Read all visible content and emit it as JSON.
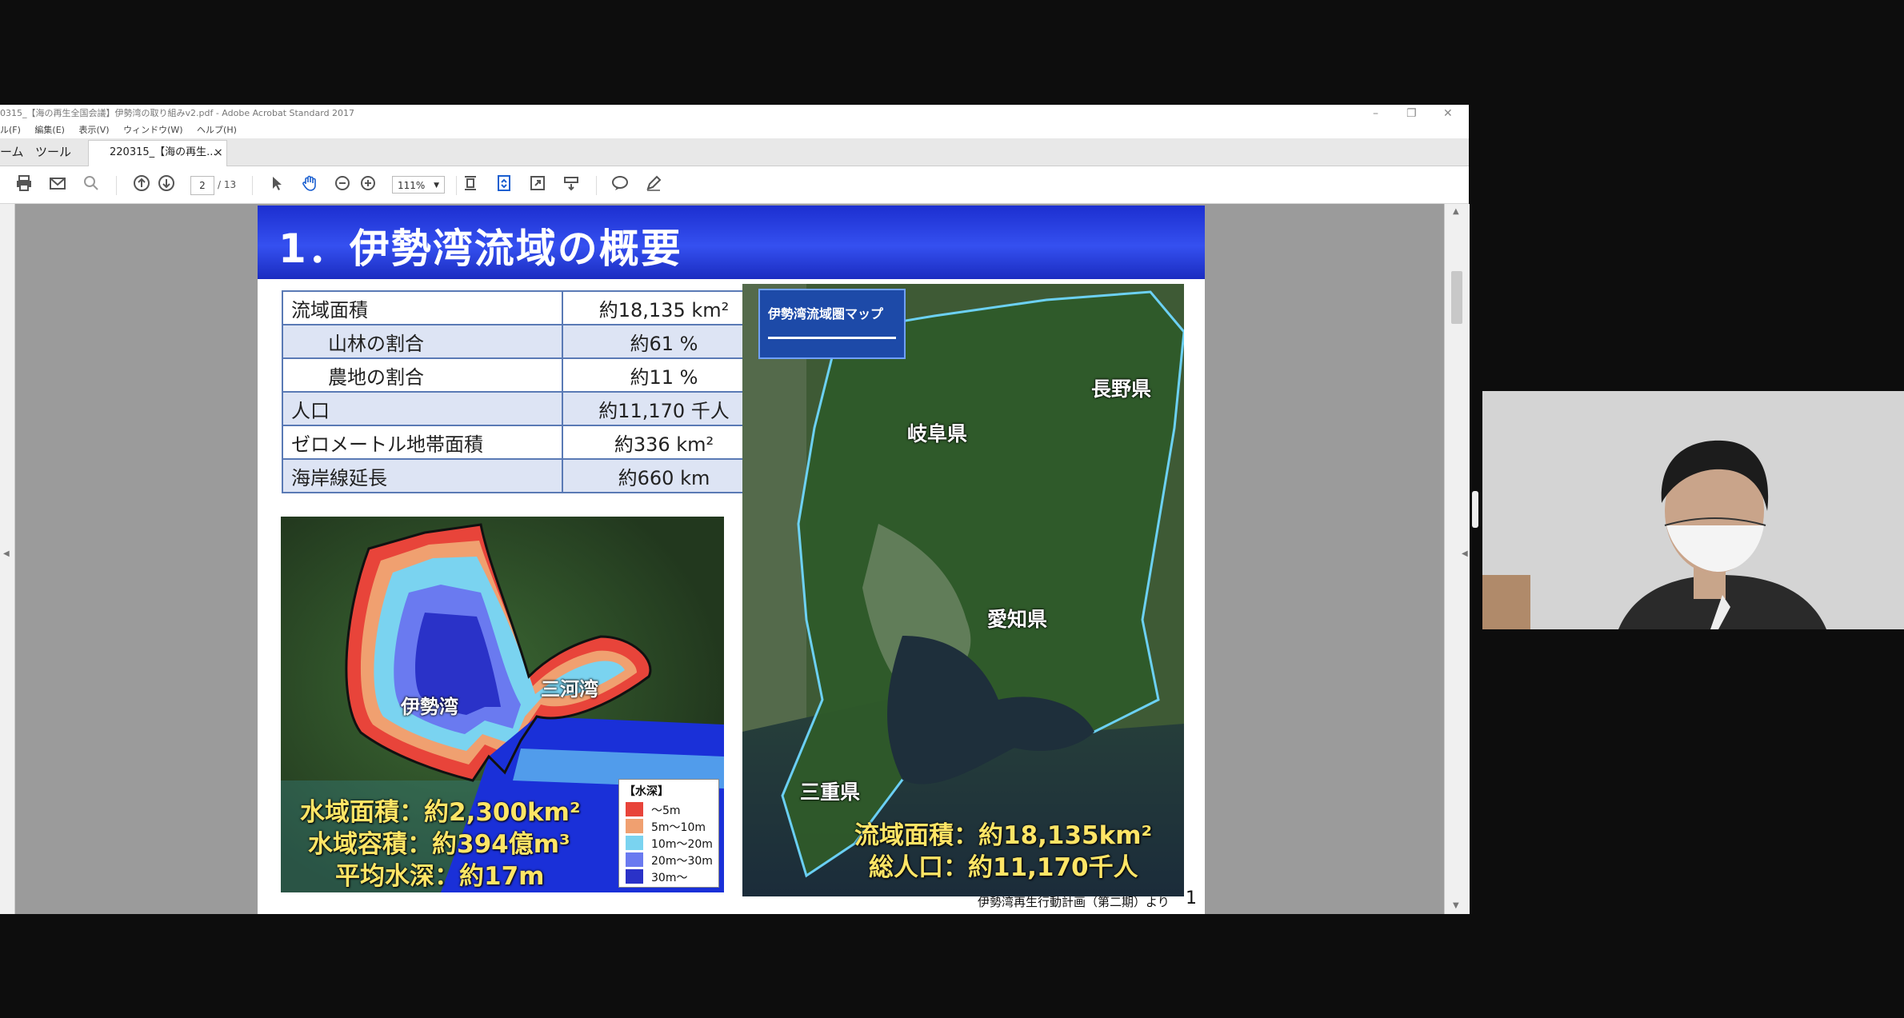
{
  "window": {
    "title": "0315_【海の再生全国会議】伊勢湾の取り組みv2.pdf - Adobe Acrobat Standard 2017",
    "controls": [
      "–",
      "❐",
      "✕"
    ]
  },
  "menu": [
    "ル(F)",
    "編集(E)",
    "表示(V)",
    "ウィンドウ(W)",
    "ヘルプ(H)"
  ],
  "tabs": {
    "home": "ーム",
    "tools": "ツール",
    "document": "220315_【海の再生...",
    "close": "×"
  },
  "toolbar": {
    "page_current": "2",
    "page_total": "/ 13",
    "zoom": "111%"
  },
  "slide": {
    "title": "1．伊勢湾流域の概要",
    "stats": [
      {
        "label": "流域面積",
        "value": "約18,135 km²",
        "indent": false,
        "shade": false
      },
      {
        "label": "山林の割合",
        "value": "約61 %",
        "indent": true,
        "shade": true
      },
      {
        "label": "農地の割合",
        "value": "約11 %",
        "indent": true,
        "shade": false
      },
      {
        "label": "人口",
        "value": "約11,170 千人",
        "indent": false,
        "shade": true
      },
      {
        "label": "ゼロメートル地帯面積",
        "value": "約336 km²",
        "indent": false,
        "shade": false
      },
      {
        "label": "海岸線延長",
        "value": "約660 km",
        "indent": false,
        "shade": true
      }
    ],
    "bay_map": {
      "label_ise": "伊勢湾",
      "label_mikawa": "三河湾",
      "area": "水域面積：約2,300km²",
      "volume": "水域容積：約394億m³",
      "depth": "平均水深：約17m",
      "legend_title": "【水深】",
      "legend": [
        {
          "label": "～5m",
          "color": "#e8443a"
        },
        {
          "label": "5m～10m",
          "color": "#f0a070"
        },
        {
          "label": "10m～20m",
          "color": "#7ad3f0"
        },
        {
          "label": "20m～30m",
          "color": "#6a7af0"
        },
        {
          "label": "30m～",
          "color": "#2a32c8"
        }
      ]
    },
    "basin_map": {
      "badge": "伊勢湾流域圏マップ",
      "gifu": "岐阜県",
      "nagano": "長野県",
      "aichi": "愛知県",
      "mie": "三重県",
      "area": "流域面積：約18,135km²",
      "population": "総人口：約11,170千人"
    },
    "source": "伊勢湾再生行動計画（第二期）より",
    "page_number": "1"
  }
}
